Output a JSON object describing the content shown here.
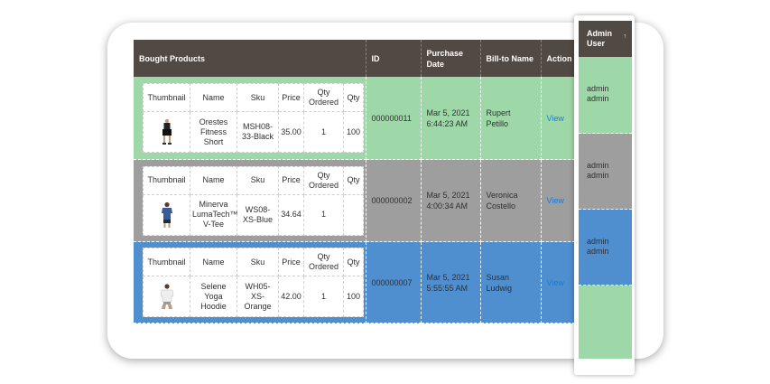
{
  "columns": {
    "bought_products": "Bought Products",
    "id": "ID",
    "purchase_date": "Purchase Date",
    "bill_to_name": "Bill-to Name",
    "action": "Action"
  },
  "inner_columns": {
    "thumbnail": "Thumbnail",
    "name": "Name",
    "sku": "Sku",
    "price": "Price",
    "qty_ordered": "Qty Ordered",
    "qty": "Qty"
  },
  "orders": [
    {
      "row_color": "#9fd8a8",
      "product": {
        "thumbnail": "shorts-image",
        "name": "Orestes Fitness Short",
        "sku": "MSH08-33-Black",
        "price": "35.00",
        "qty_ordered": "1",
        "qty": "100"
      },
      "id": "000000011",
      "purchase_date": "Mar 5, 2021 6:44:23 AM",
      "bill_to_name": "Rupert Petillo",
      "action": "View",
      "admin_user": "admin admin"
    },
    {
      "row_color": "#9e9e9e",
      "product": {
        "thumbnail": "tee-image",
        "name": "Minerva LumaTech™ V-Tee",
        "sku": "WS08-XS-Blue",
        "price": "34.64",
        "qty_ordered": "1",
        "qty": ""
      },
      "id": "000000002",
      "purchase_date": "Mar 5, 2021 4:00:34 AM",
      "bill_to_name": "Veronica Costello",
      "action": "View",
      "admin_user": "admin admin"
    },
    {
      "row_color": "#4f8fd0",
      "product": {
        "thumbnail": "hoodie-image",
        "name": "Selene Yoga Hoodie",
        "sku": "WH05-XS-Orange",
        "price": "42.00",
        "qty_ordered": "1",
        "qty": "100"
      },
      "id": "000000007",
      "purchase_date": "Mar 5, 2021 5:55:55 AM",
      "bill_to_name": "Susan Ludwig",
      "action": "View",
      "admin_user": "admin admin"
    }
  ],
  "admin_panel": {
    "header": "Admin User",
    "sort_icon": "sort-ascending-icon"
  }
}
